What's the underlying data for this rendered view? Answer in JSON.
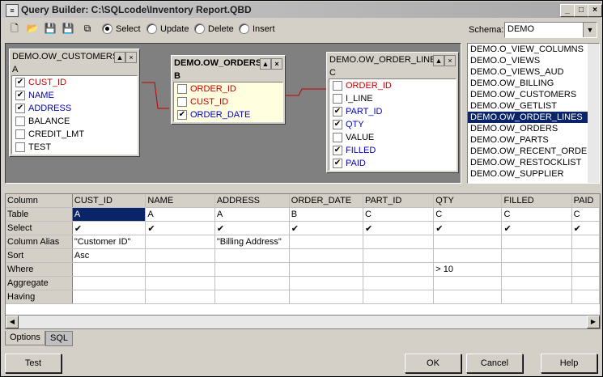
{
  "window": {
    "title": "Query Builder: C:\\SQLcode\\Inventory Report.QBD"
  },
  "toolbar": {
    "modes": [
      {
        "label": "Select",
        "selected": true
      },
      {
        "label": "Update",
        "selected": false
      },
      {
        "label": "Delete",
        "selected": false
      },
      {
        "label": "Insert",
        "selected": false
      }
    ],
    "schema_label": "Schema:",
    "schema_value": "DEMO"
  },
  "tables": [
    {
      "name": "DEMO.OW_CUSTOMERS",
      "alias": "A",
      "cols": [
        {
          "name": "CUST_ID",
          "checked": true,
          "color": "red"
        },
        {
          "name": "NAME",
          "checked": true,
          "color": "blue"
        },
        {
          "name": "ADDRESS",
          "checked": true,
          "color": "blue"
        },
        {
          "name": "BALANCE",
          "checked": false,
          "color": "black"
        },
        {
          "name": "CREDIT_LMT",
          "checked": false,
          "color": "black"
        },
        {
          "name": "TEST",
          "checked": false,
          "color": "black"
        }
      ]
    },
    {
      "name": "DEMO.OW_ORDERS",
      "alias": "B",
      "cols": [
        {
          "name": "ORDER_ID",
          "checked": false,
          "color": "red"
        },
        {
          "name": "CUST_ID",
          "checked": false,
          "color": "red"
        },
        {
          "name": "ORDER_DATE",
          "checked": true,
          "color": "blue"
        }
      ]
    },
    {
      "name": "DEMO.OW_ORDER_LINES",
      "alias": "C",
      "cols": [
        {
          "name": "ORDER_ID",
          "checked": false,
          "color": "red"
        },
        {
          "name": "I_LINE",
          "checked": false,
          "color": "black"
        },
        {
          "name": "PART_ID",
          "checked": true,
          "color": "blue"
        },
        {
          "name": "QTY",
          "checked": true,
          "color": "blue"
        },
        {
          "name": "VALUE",
          "checked": false,
          "color": "black"
        },
        {
          "name": "FILLED",
          "checked": true,
          "color": "blue"
        },
        {
          "name": "PAID",
          "checked": true,
          "color": "blue"
        }
      ]
    }
  ],
  "schema_list": {
    "items": [
      "DEMO.O_VIEW_COLUMNS",
      "DEMO.O_VIEWS",
      "DEMO.O_VIEWS_AUD",
      "DEMO.OW_BILLING",
      "DEMO.OW_CUSTOMERS",
      "DEMO.OW_GETLIST",
      "DEMO.OW_ORDER_LINES",
      "DEMO.OW_ORDERS",
      "DEMO.OW_PARTS",
      "DEMO.OW_RECENT_ORDERS",
      "DEMO.OW_RESTOCKLIST",
      "DEMO.OW_SUPPLIER"
    ],
    "selected": 6
  },
  "grid": {
    "row_headers": [
      "Column",
      "Table",
      "Select",
      "Column Alias",
      "Sort",
      "Where",
      "Aggregate",
      "Having"
    ],
    "columns": [
      {
        "Column": "CUST_ID",
        "Table": "A",
        "Select": "✔",
        "Column Alias": "\"Customer ID\"",
        "Sort": "Asc",
        "Where": "",
        "Aggregate": "",
        "Having": ""
      },
      {
        "Column": "NAME",
        "Table": "A",
        "Select": "✔",
        "Column Alias": "",
        "Sort": "",
        "Where": "",
        "Aggregate": "",
        "Having": ""
      },
      {
        "Column": "ADDRESS",
        "Table": "A",
        "Select": "✔",
        "Column Alias": "\"Billing Address\"",
        "Sort": "",
        "Where": "",
        "Aggregate": "",
        "Having": ""
      },
      {
        "Column": "ORDER_DATE",
        "Table": "B",
        "Select": "✔",
        "Column Alias": "",
        "Sort": "",
        "Where": "",
        "Aggregate": "",
        "Having": ""
      },
      {
        "Column": "PART_ID",
        "Table": "C",
        "Select": "✔",
        "Column Alias": "",
        "Sort": "",
        "Where": "",
        "Aggregate": "",
        "Having": ""
      },
      {
        "Column": "QTY",
        "Table": "C",
        "Select": "✔",
        "Column Alias": "",
        "Sort": "",
        "Where": "> 10",
        "Aggregate": "",
        "Having": ""
      },
      {
        "Column": "FILLED",
        "Table": "C",
        "Select": "✔",
        "Column Alias": "",
        "Sort": "",
        "Where": "",
        "Aggregate": "",
        "Having": ""
      },
      {
        "Column": "PAID",
        "Table": "C",
        "Select": "✔",
        "Column Alias": "",
        "Sort": "",
        "Where": "",
        "Aggregate": "",
        "Having": ""
      }
    ]
  },
  "tabs": [
    "Options",
    "SQL"
  ],
  "buttons": {
    "test": "Test",
    "ok": "OK",
    "cancel": "Cancel",
    "help": "Help"
  }
}
